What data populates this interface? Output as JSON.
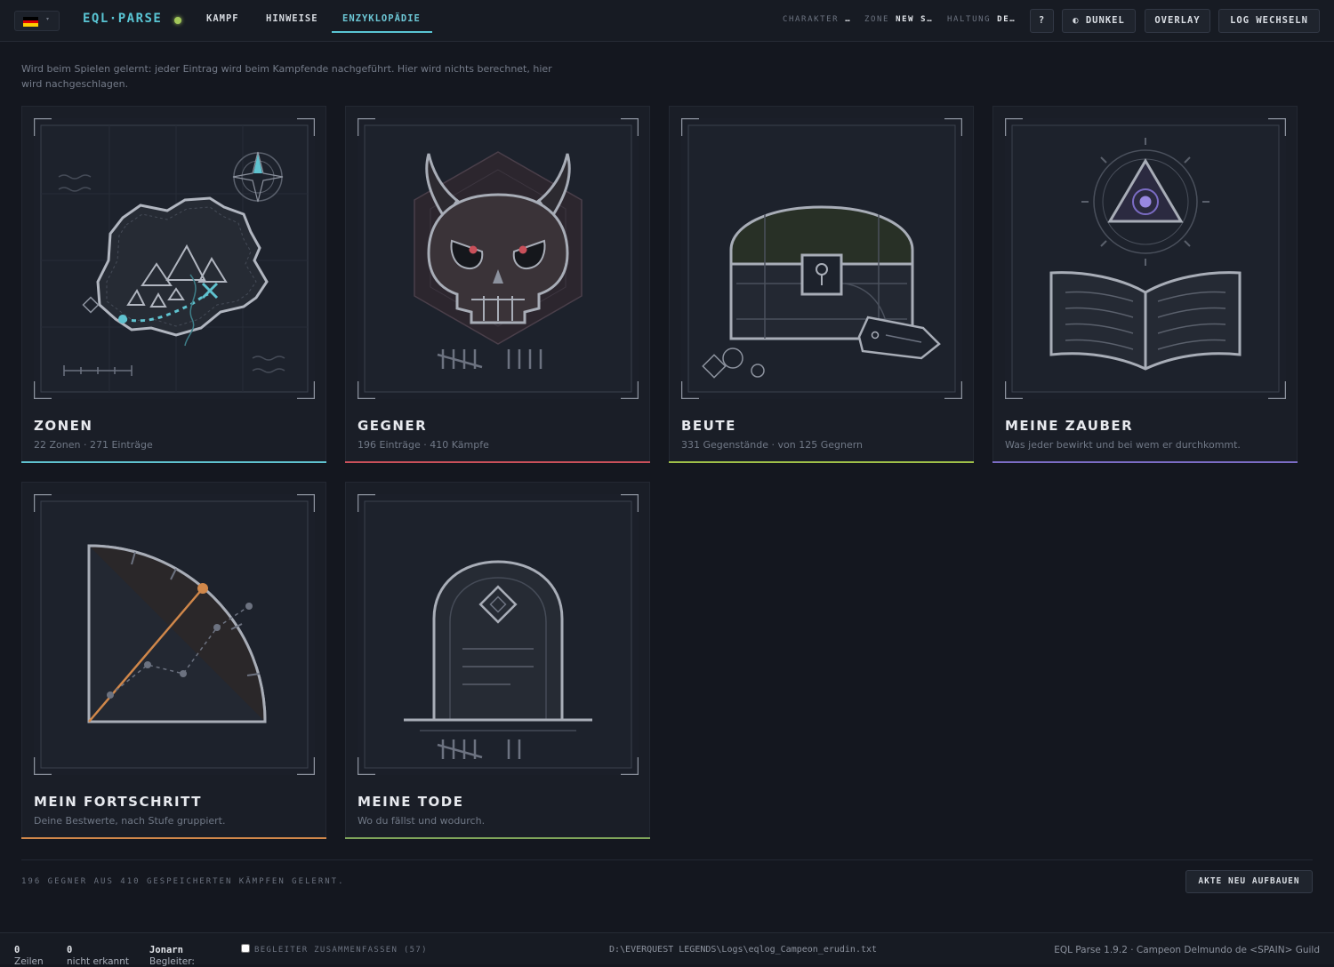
{
  "header": {
    "language": "de",
    "flag_colors": [
      "#000000",
      "#dd0000",
      "#ffce00"
    ],
    "brand": "EQL·PARSE",
    "status_color": "#a3c85a",
    "nav": [
      {
        "label": "KAMPF",
        "active": false
      },
      {
        "label": "HINWEISE",
        "active": false
      },
      {
        "label": "ENZYKLOPÄDIE",
        "active": true
      }
    ],
    "meta": [
      {
        "label": "CHARAKTER",
        "value": "…"
      },
      {
        "label": "ZONE",
        "value": "NEW S…"
      },
      {
        "label": "HALTUNG",
        "value": "DE…"
      }
    ],
    "help_label": "?",
    "theme_icon": "half-circle-icon",
    "theme_label": "DUNKEL",
    "overlay_label": "OVERLAY",
    "log_label": "LOG WECHSELN"
  },
  "intro": "Wird beim Spielen gelernt: jeder Eintrag wird beim Kampfende nachgeführt. Hier wird nichts berechnet, hier wird nachgeschlagen.",
  "cards": [
    {
      "title": "ZONEN",
      "subtitle": "22 Zonen · 271 Einträge",
      "accent": "#5fc2cf",
      "icon": "treasure-map-icon"
    },
    {
      "title": "GEGNER",
      "subtitle": "196 Einträge · 410 Kämpfe",
      "accent": "#c9505a",
      "icon": "horned-skull-icon"
    },
    {
      "title": "BEUTE",
      "subtitle": "331 Gegenstände · von 125 Gegnern",
      "accent": "#9fc048",
      "icon": "treasure-chest-icon"
    },
    {
      "title": "MEINE ZAUBER",
      "subtitle": "Was jeder bewirkt und bei wem er durchkommt.",
      "accent": "#7b6cc4",
      "icon": "spellbook-icon"
    },
    {
      "title": "MEIN FORTSCHRITT",
      "subtitle": "Deine Bestwerte, nach Stufe gruppiert.",
      "accent": "#d0874a",
      "icon": "progress-gauge-icon"
    },
    {
      "title": "MEINE TODE",
      "subtitle": "Wo du fällst und wodurch.",
      "accent": "#7fa55a",
      "icon": "tombstone-icon"
    }
  ],
  "summary": "196 GEGNER AUS 410 GESPEICHERTEN KÄMPFEN GELERNT.",
  "rebuild_label": "AKTE NEU AUFBAUEN",
  "footer": {
    "rows_label": "Zeilen",
    "rows_value": "0",
    "unknown_label": "nicht erkannt",
    "unknown_value": "0",
    "companion_label": "Begleiter:",
    "companion_value": "Jonarn",
    "merge_label": "BEGLEITER ZUSAMMENFASSEN (57)",
    "merge_checked": false,
    "log_path": "D:\\EVERQUEST LEGENDS\\Logs\\eqlog_Campeon_erudin.txt",
    "version": "EQL Parse 1.9.2 · Campeon Delmundo de <SPAIN> Guild"
  }
}
